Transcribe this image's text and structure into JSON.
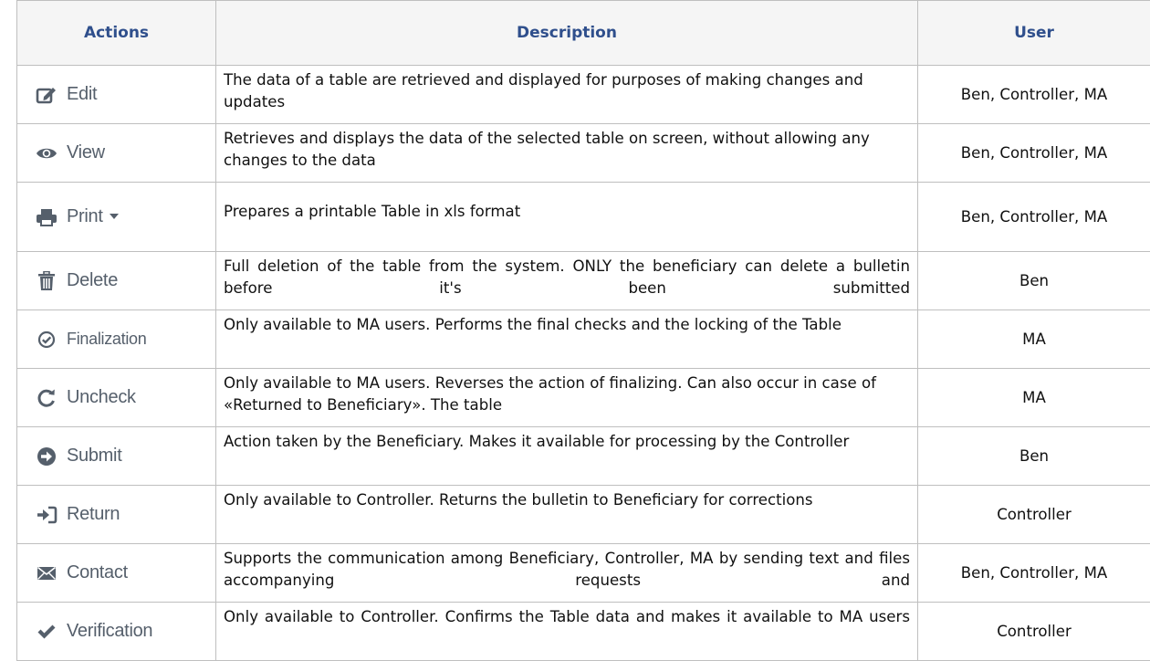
{
  "header": {
    "actions": "Actions",
    "description": "Description",
    "user": "User"
  },
  "rows": [
    {
      "action": "Edit",
      "icon": "edit-icon",
      "description": "The data of a table are retrieved and displayed for purposes of making changes and updates",
      "user": "Ben, Controller, MA"
    },
    {
      "action": "View",
      "icon": "eye-icon",
      "description": "Retrieves and displays the data of the selected table on screen, without allowing any changes to the data",
      "user": "Ben, Controller, MA"
    },
    {
      "action": "Print",
      "icon": "printer-icon",
      "description": "Prepares a printable Table in xls format",
      "user": "Ben, Controller, MA"
    },
    {
      "action": "Delete",
      "icon": "trash-icon",
      "description": "Full deletion of the table from the system. ONLY the beneficiary can delete a bulletin before it's been submitted",
      "user": "Ben"
    },
    {
      "action": "Finalization",
      "icon": "check-circle-icon",
      "description": "Only available to MA users. Performs the final checks and the locking of the Table",
      "user": "MA"
    },
    {
      "action": "Uncheck",
      "icon": "rotate-icon",
      "description": "Only available to MA users. Reverses the action of finalizing. Can also occur in case of «Returned to Beneficiary». The table",
      "user": "MA"
    },
    {
      "action": "Submit",
      "icon": "arrow-circle-right-icon",
      "description": "Action taken by the Beneficiary. Makes it available for processing by the Controller",
      "user": "Ben"
    },
    {
      "action": "Return",
      "icon": "sign-in-icon",
      "description": "Only available to Controller. Returns the bulletin to Beneficiary for corrections",
      "user": "Controller"
    },
    {
      "action": "Contact",
      "icon": "envelope-icon",
      "description": "Supports the communication among Beneficiary, Controller, MA by sending text and files accompanying requests and",
      "user": "Ben, Controller, MA"
    },
    {
      "action": "Verification",
      "icon": "checkmark-icon",
      "description": "Only available to Controller. Confirms the Table data and makes it available to MA users",
      "user": "Controller"
    }
  ],
  "colors": {
    "header_text": "#2f4f8c",
    "action_text": "#555f6b",
    "border": "#bfbfbf"
  }
}
